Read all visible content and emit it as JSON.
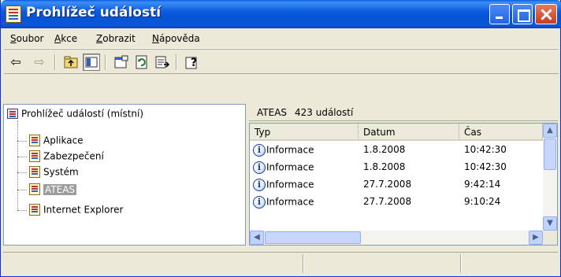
{
  "window": {
    "title": "Prohlížeč událostí",
    "icon": "event-viewer-icon"
  },
  "menu": [
    {
      "accel": "S",
      "rest": "oubor"
    },
    {
      "accel": "A",
      "rest": "kce"
    },
    {
      "accel": "Z",
      "rest": "obrazit"
    },
    {
      "accel": "N",
      "rest": "ápověda"
    }
  ],
  "toolbar": {
    "back_icon": "back-arrow-icon",
    "forward_icon": "forward-arrow-icon",
    "up_icon": "up-folder-icon",
    "tree_icon": "show-tree-icon",
    "properties_icon": "properties-icon",
    "refresh_icon": "refresh-icon",
    "export_icon": "export-list-icon",
    "help_icon": "help-icon"
  },
  "tree": {
    "root": "Prohlížeč událostí (místní)",
    "items": [
      {
        "label": "Aplikace"
      },
      {
        "label": "Zabezpečení"
      },
      {
        "label": "Systém"
      },
      {
        "label": "ATEAS",
        "selected": true
      },
      {
        "label": "Internet Explorer"
      }
    ]
  },
  "pane": {
    "log_name": "ATEAS",
    "count_label": "423 událostí"
  },
  "list": {
    "columns": [
      "Typ",
      "Datum",
      "Čas"
    ],
    "rows": [
      {
        "type": "Informace",
        "date": "1.8.2008",
        "time": "10:42:30"
      },
      {
        "type": "Informace",
        "date": "1.8.2008",
        "time": "10:42:30"
      },
      {
        "type": "Informace",
        "date": "27.7.2008",
        "time": "9:42:14"
      },
      {
        "type": "Informace",
        "date": "27.7.2008",
        "time": "9:10:24"
      }
    ],
    "info_icon_glyph": "i",
    "scroll_up_glyph": "▲",
    "scroll_down_glyph": "▼",
    "scroll_left_glyph": "◀",
    "scroll_right_glyph": "▶"
  },
  "colors": {
    "titlebar": "#0a5fdb",
    "selection": "#9d9da1"
  }
}
